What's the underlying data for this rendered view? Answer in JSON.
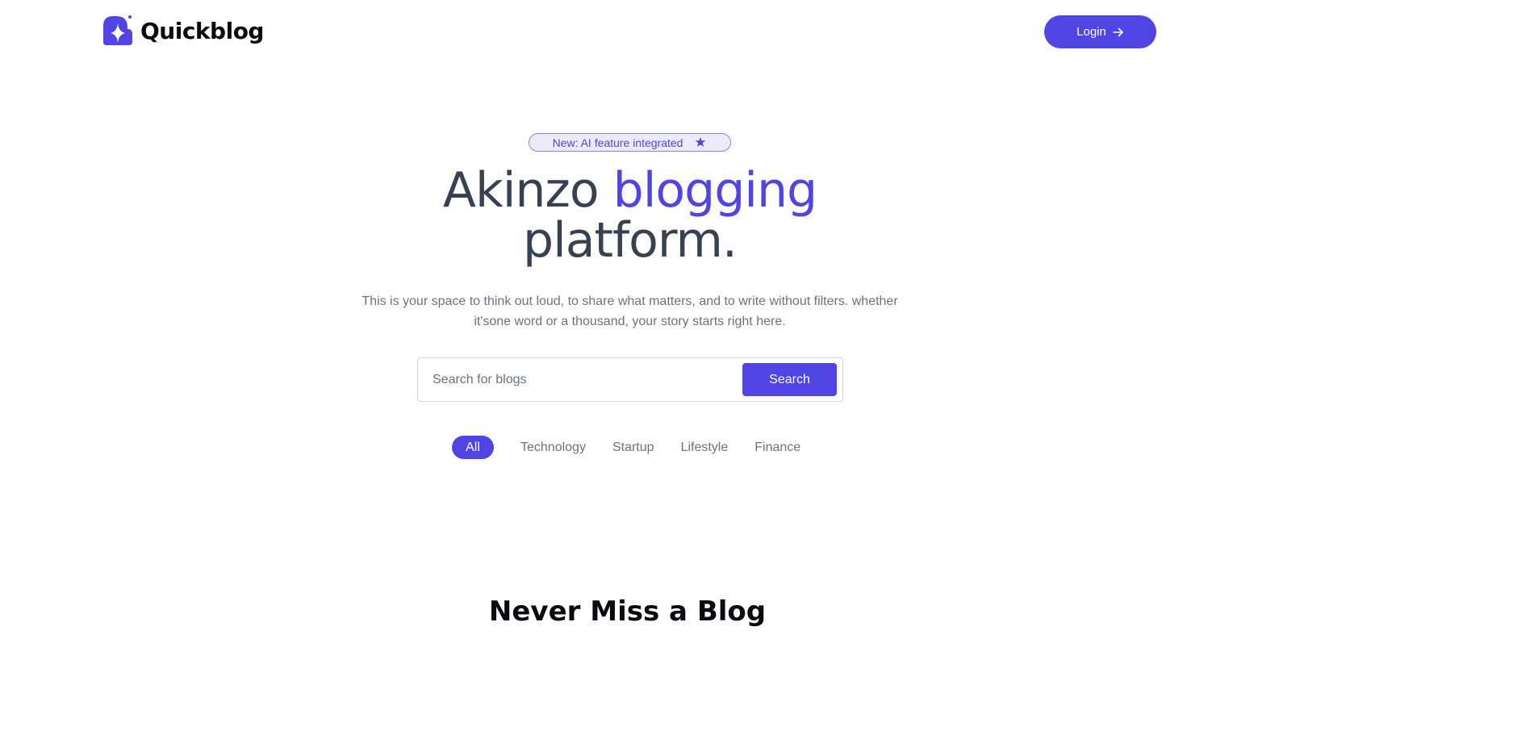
{
  "header": {
    "logo_text": "Quickblog",
    "login_label": "Login"
  },
  "hero": {
    "badge_text": "New: AI feature integrated",
    "title_part1": "Akinzo ",
    "title_accent": "blogging",
    "title_part2": "platform.",
    "subtitle": "This is your space to think out loud, to share what matters, and to write without filters. whether it'sone word or a thousand, your story starts right here."
  },
  "search": {
    "placeholder": "Search for blogs",
    "value": "",
    "button_label": "Search"
  },
  "categories": [
    "All",
    "Technology",
    "Startup",
    "Lifestyle",
    "Finance"
  ],
  "active_category": "All",
  "newsletter": {
    "heading": "Never Miss a Blog"
  },
  "colors": {
    "accent": "#5044e5",
    "text": "#374151",
    "muted": "#6b7280"
  },
  "icons": {
    "logo": "logo-sparkle-icon",
    "login": "arrow-right-icon",
    "badge": "star-icon"
  }
}
